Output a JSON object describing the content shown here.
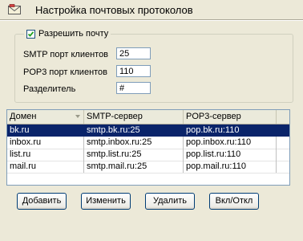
{
  "header": {
    "title": "Настройка почтовых протоколов",
    "icon": "envelope-icon"
  },
  "mail_group": {
    "enable_label": "Разрешить почту",
    "enable_checked": true
  },
  "fields": {
    "smtp_port_label": "SMTP порт клиентов",
    "smtp_port_value": "25",
    "pop3_port_label": "POP3 порт клиентов",
    "pop3_port_value": "110",
    "separator_label": "Разделитель",
    "separator_value": "#"
  },
  "table": {
    "columns": [
      "Домен",
      "SMTP-сервер",
      "POP3-сервер"
    ],
    "rows": [
      {
        "domain": "bk.ru",
        "smtp": "smtp.bk.ru:25",
        "pop3": "pop.bk.ru:110",
        "selected": true
      },
      {
        "domain": "inbox.ru",
        "smtp": "smtp.inbox.ru:25",
        "pop3": "pop.inbox.ru:110",
        "selected": false
      },
      {
        "domain": "list.ru",
        "smtp": "smtp.list.ru:25",
        "pop3": "pop.list.ru:110",
        "selected": false
      },
      {
        "domain": "mail.ru",
        "smtp": "smtp.mail.ru:25",
        "pop3": "pop.mail.ru:110",
        "selected": false
      }
    ]
  },
  "buttons": {
    "add": "Добавить",
    "edit": "Изменить",
    "delete": "Удалить",
    "toggle": "Вкл/Откл"
  },
  "colors": {
    "selection": "#0a246a",
    "background": "#ece9d8"
  }
}
